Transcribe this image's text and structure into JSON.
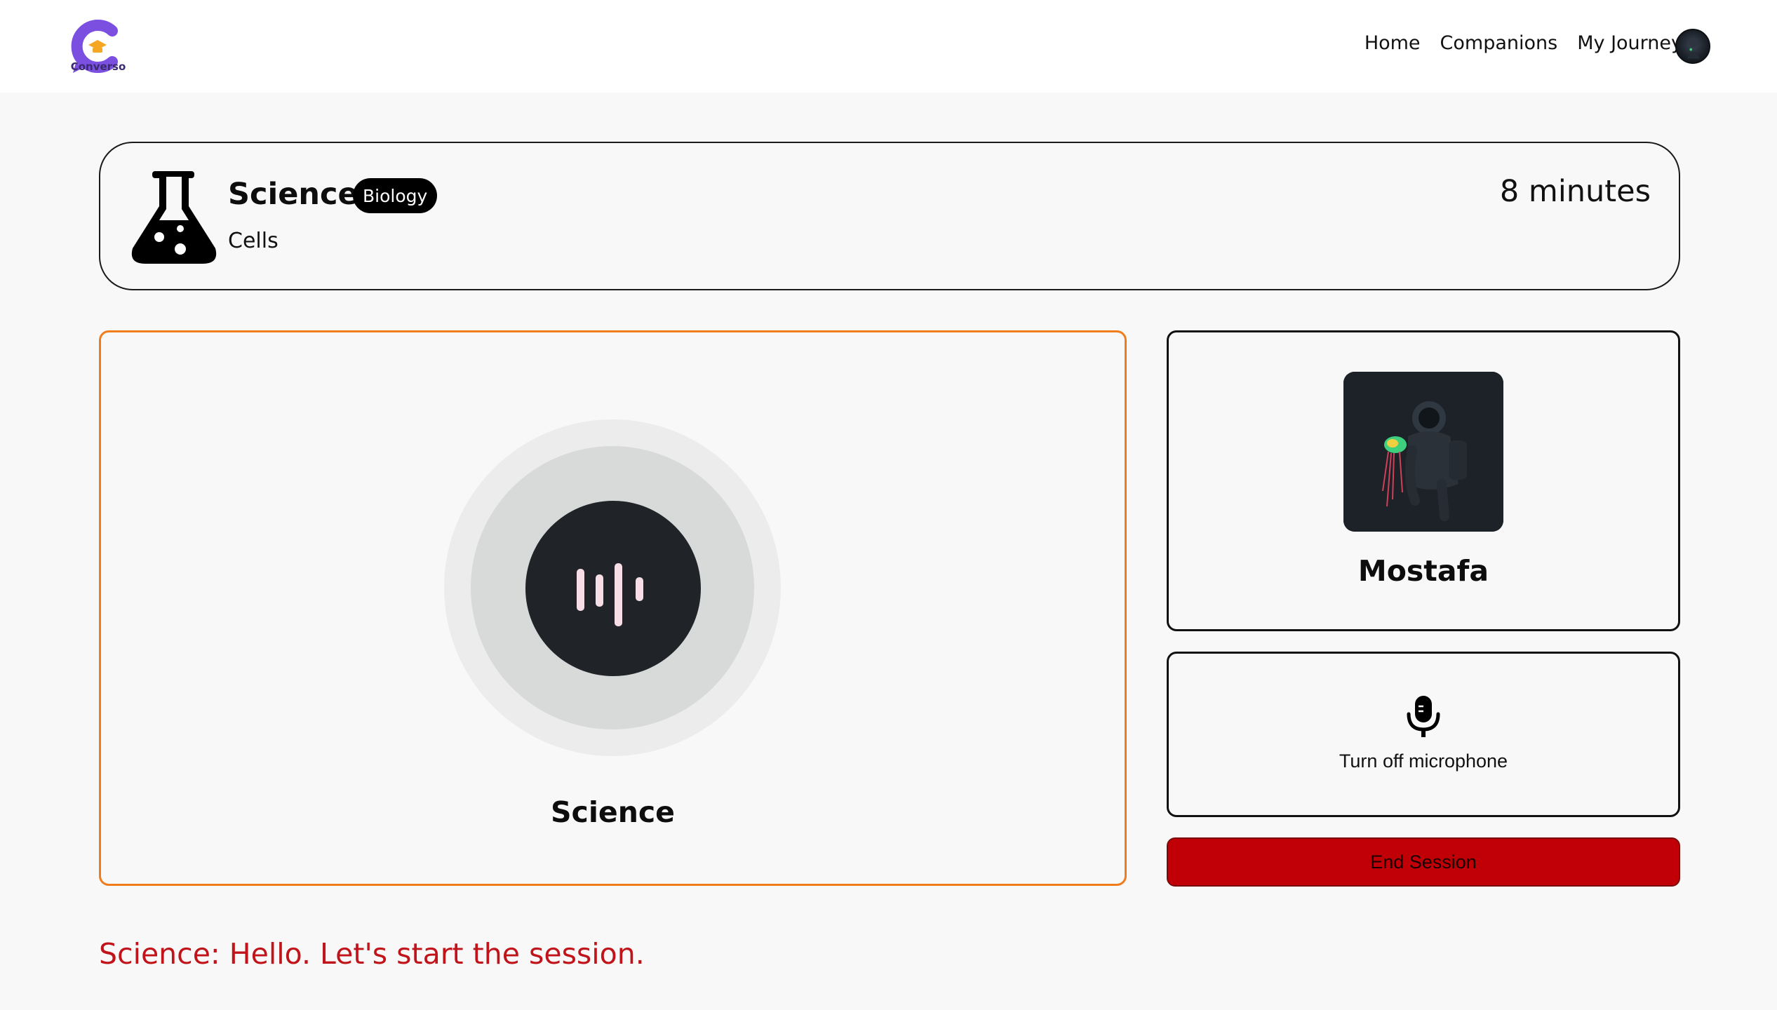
{
  "app": {
    "logo_text": "Converso"
  },
  "nav": {
    "links": [
      "Home",
      "Companions",
      "My Journey"
    ]
  },
  "session": {
    "subject": "Science",
    "badge": "Biology",
    "topic": "Cells",
    "duration": "8 minutes"
  },
  "companion": {
    "name": "Science"
  },
  "user": {
    "name": "Mostafa"
  },
  "controls": {
    "mic_label": "Turn off microphone",
    "end_label": "End Session"
  },
  "transcript": {
    "line": "Science: Hello. Let's start the session."
  },
  "colors": {
    "accent_orange": "#f07c1c",
    "end_red": "#c00006",
    "transcript_red": "#c0141a",
    "brand_purple": "#7b4fe0"
  }
}
